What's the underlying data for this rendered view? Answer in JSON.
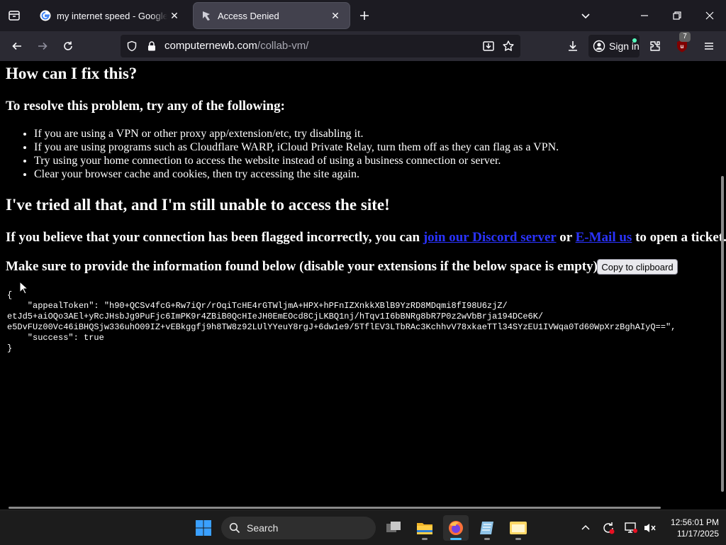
{
  "browser": {
    "tabs": [
      {
        "title": "my internet speed - Google Search",
        "active": false
      },
      {
        "title": "Access Denied",
        "active": true
      }
    ],
    "url": {
      "host": "computernewb.com",
      "path": "/collab-vm/"
    },
    "signin_label": "Sign in",
    "extension_badge": "7"
  },
  "page": {
    "heading_fix": "How can I fix this?",
    "heading_resolve": "To resolve this problem, try any of the following:",
    "fix_items": [
      "If you are using a VPN or other proxy app/extension/etc, try disabling it.",
      "If you are using programs such as Cloudflare WARP, iCloud Private Relay, turn them off as they can flag as a VPN.",
      "Try using your home connection to access the website instead of using a business connection or server.",
      "Clear your browser cache and cookies, then try accessing the site again."
    ],
    "heading_tried": "I've tried all that, and I'm still unable to access the site!",
    "flagged": {
      "prefix": "If you believe that your connection has been flagged incorrectly, you can ",
      "discord_link": "join our Discord server",
      "or": " or ",
      "email_link": "E-Mail us",
      "suffix": " to open a ticket."
    },
    "info_text": "Make sure to provide the information found below (disable your extensions if the below space is empty):",
    "copy_button": "Copy to clipboard",
    "json_text": "{\n    \"appealToken\": \"h90+QCSv4fcG+Rw7iQr/rOqiTcHE4rGTWljmA+HPX+hPFnIZXnkkXBlB9YzRD8MDqmi8fI98U6zjZ/\netJd5+aiOQo3AEl+yRcJHsbJg9PuFjc6ImPK9r4ZBiB0QcHIeJH0EmEOcd8CjLKBQ1nj/hTqv1I6bBNRg8bR7P0z2wVbBrja194DCe6K/\ne5DvFUz00Vc46iBHQSjw336uhO09IZ+vEBkggfj9h8TW8z92LUlYYeuY8rgJ+6dw1e9/5TflEV3LTbRAc3KchhvV78xkaeTTl34SYzEU1IVWqa0Td60WpXrzBghAIyQ==\",\n    \"success\": true\n}"
  },
  "taskbar": {
    "search_placeholder": "Search",
    "time": "12:56:01 PM",
    "date": "11/17/2025"
  }
}
